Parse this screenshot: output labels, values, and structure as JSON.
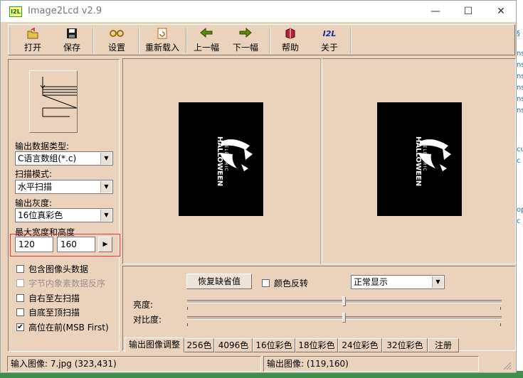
{
  "window": {
    "title": "Image2Lcd v2.9",
    "app_icon_text": "I2L"
  },
  "titlebar_controls": {
    "minimize": "—",
    "maximize": "☐",
    "close": "✕"
  },
  "toolbar": {
    "open": "打开",
    "save": "保存",
    "settings": "设置",
    "reload": "重新载入",
    "prev": "上一幅",
    "next": "下一幅",
    "help": "帮助",
    "about": "关于",
    "about_icon_text": "I2L"
  },
  "left": {
    "output_type_label": "输出数据类型:",
    "output_type_value": "C语言数组(*.c)",
    "scan_mode_label": "扫描模式:",
    "scan_mode_value": "水平扫描",
    "gray_label": "输出灰度:",
    "gray_value": "16位真彩色",
    "max_size_label": "最大宽度和高度",
    "max_width": "120",
    "max_height": "160",
    "options": [
      {
        "label": "包含图像头数据",
        "checked": false,
        "enabled": true
      },
      {
        "label": "字节内象素数据反序",
        "checked": false,
        "enabled": false
      },
      {
        "label": "自右至左扫描",
        "checked": false,
        "enabled": true
      },
      {
        "label": "自底至顶扫描",
        "checked": false,
        "enabled": true
      },
      {
        "label": "高位在前(MSB First)",
        "checked": true,
        "enabled": true
      }
    ]
  },
  "preview": {
    "poster_small": "ELECTRIC",
    "poster_big": "HALLOWEEN"
  },
  "adjust": {
    "restore_label": "恢复缺省值",
    "invert_label": "颜色反转",
    "display_mode": "正常显示",
    "brightness_label": "亮度:",
    "contrast_label": "对比度:",
    "brightness_value": 0.5,
    "contrast_value": 0.5
  },
  "tabs": [
    "输出图像调整",
    "256色",
    "4096色",
    "16位彩色",
    "18位彩色",
    "24位彩色",
    "32位彩色",
    "注册"
  ],
  "status": {
    "input": "输入图像: 7.jpg (323,431)",
    "output": "输出图像: (119,160)"
  },
  "colors": {
    "accent_highlight": "#e03a3a",
    "window_bg": "#ead2bd"
  }
}
